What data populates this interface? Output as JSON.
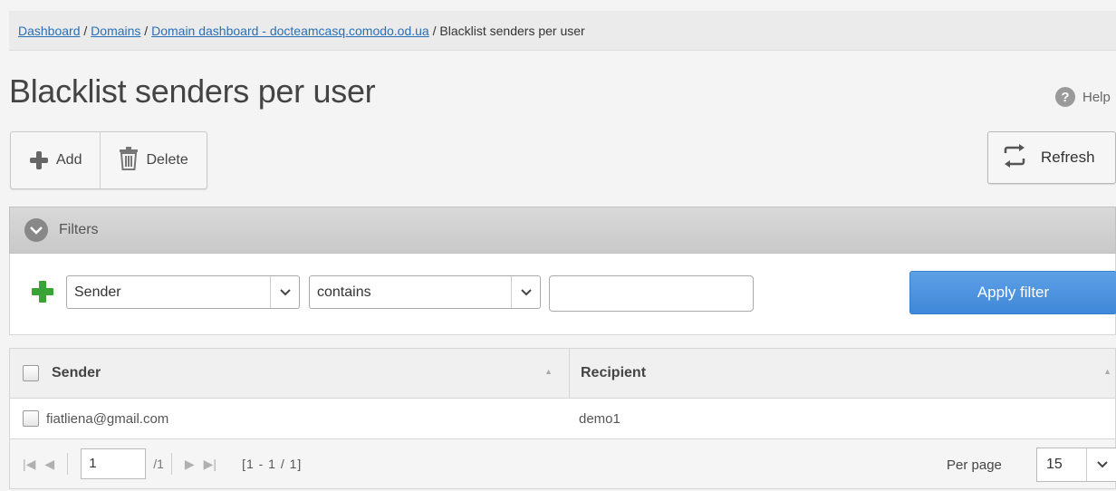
{
  "breadcrumb": {
    "items": [
      "Dashboard",
      "Domains",
      "Domain dashboard - docteamcasq.comodo.od.ua"
    ],
    "separator": " / ",
    "current": "Blacklist senders per user"
  },
  "page_title": "Blacklist senders per user",
  "help_label": "Help",
  "toolbar": {
    "add_label": "Add",
    "delete_label": "Delete",
    "refresh_label": "Refresh"
  },
  "filters": {
    "title": "Filters",
    "field_value": "Sender",
    "operator_value": "contains",
    "text_value": "",
    "apply_label": "Apply filter"
  },
  "table": {
    "columns": [
      "Sender",
      "Recipient"
    ],
    "rows": [
      {
        "sender": "fiatliena@gmail.com",
        "recipient": "demo1"
      }
    ]
  },
  "pagination": {
    "page": "1",
    "total_pages": "/1",
    "range": "[1 - 1 / 1]",
    "per_page_label": "Per page",
    "per_page_value": "15"
  },
  "colors": {
    "link": "#2a6fb5",
    "apply_button": "#4a90dc",
    "add_filter_plus": "#3aa336"
  }
}
